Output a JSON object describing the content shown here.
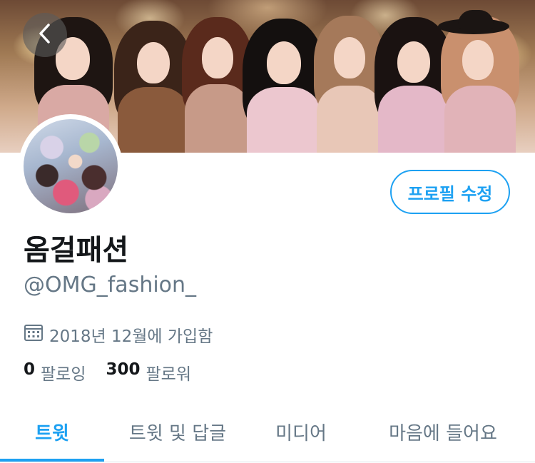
{
  "header": {
    "back_icon": "chevron-left-icon"
  },
  "profile": {
    "edit_button_label": "프로필 수정",
    "display_name": "옴걸패션",
    "handle": "@OMG_fashion_",
    "joined_icon": "calendar-icon",
    "joined_text": "2018년 12월에 가입함",
    "following_count": "0",
    "following_label": "팔로잉",
    "followers_count": "300",
    "followers_label": "팔로워"
  },
  "tabs": [
    {
      "label": "트윗",
      "active": true
    },
    {
      "label": "트윗 및 답글",
      "active": false
    },
    {
      "label": "미디어",
      "active": false
    },
    {
      "label": "마음에 들어요",
      "active": false
    }
  ],
  "colors": {
    "accent": "#1da1f2",
    "secondary_text": "#657786",
    "primary_text": "#14171a"
  }
}
